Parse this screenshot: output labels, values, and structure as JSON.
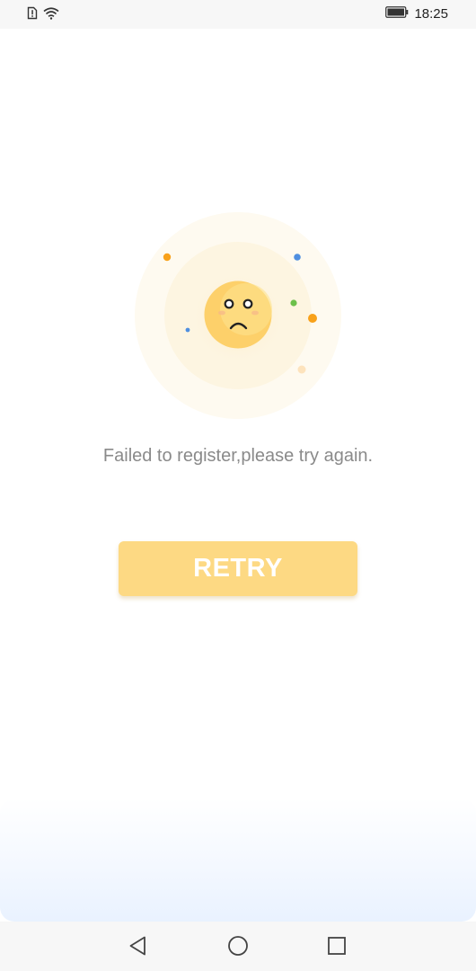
{
  "status_bar": {
    "time": "18:25",
    "icons": [
      "sim-alert-icon",
      "wifi-icon",
      "battery-icon"
    ]
  },
  "main": {
    "message": "Failed to register,please try again.",
    "illustration": "sad-face-icon"
  },
  "retry_button": {
    "label": "RETRY"
  },
  "nav_bar": {
    "icons": [
      "back-icon",
      "home-icon",
      "recent-apps-icon"
    ]
  },
  "colors": {
    "accent": "#fdd983",
    "face": "#fdd06a",
    "text_muted": "#8a8a8a"
  }
}
